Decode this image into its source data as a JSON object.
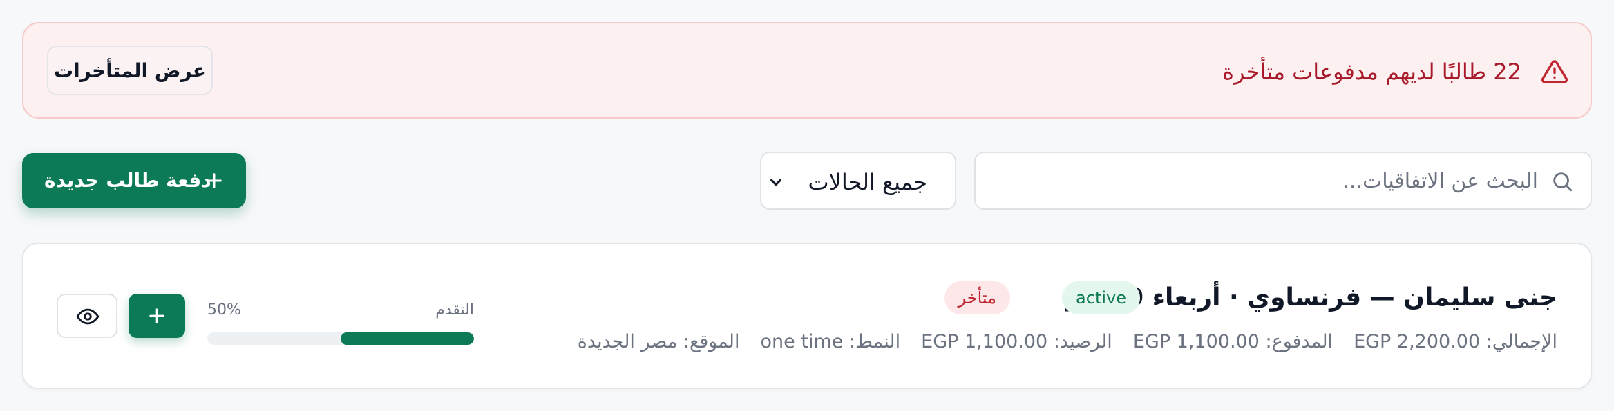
{
  "alert": {
    "text": "22 طالبًا لديهم مدفوعات متأخرة",
    "button_label": "عرض المتأخرات",
    "icon": "warning-triangle-icon",
    "color": "#a8192a"
  },
  "toolbar": {
    "search_placeholder": "البحث عن الاتفاقيات...",
    "search_value": "",
    "status_filter": {
      "selected": "جميع الحالات",
      "options": [
        "جميع الحالات"
      ]
    },
    "new_payment_label": "دفعة طالب جديدة",
    "accent": "#0c7a56"
  },
  "agreements": [
    {
      "title": "جنى سليمان — فرنساوي · أربعاء 6:30م",
      "status_badge": "active",
      "overdue_badge": "متأخر",
      "total": "الإجمالي: EGP 2,200.00",
      "paid": "المدفوع: EGP 1,100.00",
      "balance": "الرصيد: EGP 1,100.00",
      "pattern": "النمط: one time",
      "location": "الموقع: مصر الجديدة",
      "progress_label": "التقدم",
      "progress_text": "50%",
      "progress": 0.5
    }
  ]
}
